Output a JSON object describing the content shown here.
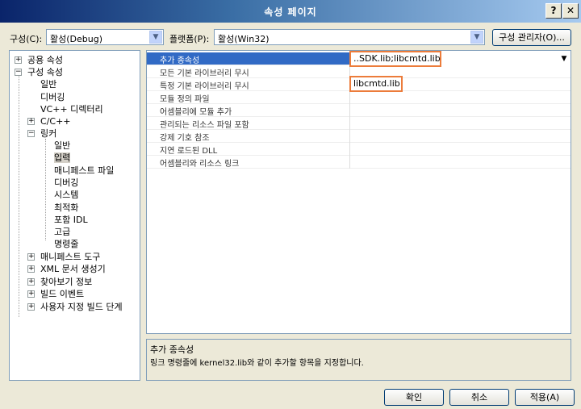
{
  "window": {
    "title": "속성 페이지",
    "help_btn": "?",
    "close_btn": "✕"
  },
  "config": {
    "label": "구성(C):",
    "value": "활성(Debug)"
  },
  "platform": {
    "label": "플랫폼(P):",
    "value": "활성(Win32)"
  },
  "config_manager_button": "구성 관리자(O)...",
  "tree": {
    "common": "공용 속성",
    "config": "구성 속성",
    "general": "일반",
    "debugging": "디버깅",
    "vcdirs": "VC++ 디렉터리",
    "cc": "C/C++",
    "linker": "링커",
    "linker_children": [
      "일반",
      "입력",
      "매니페스트 파일",
      "디버깅",
      "시스템",
      "최적화",
      "포함 IDL",
      "고급",
      "명령줄"
    ],
    "manifest_tool": "매니페스트 도구",
    "xml_doc": "XML 문서 생성기",
    "browse_info": "찾아보기 정보",
    "build_events": "빌드 이벤트",
    "custom_build": "사용자 지정 빌드 단계"
  },
  "properties": [
    {
      "name": "추가 종속성",
      "value": "..SDK.lib;libcmtd.lib"
    },
    {
      "name": "모든 기본 라이브러리 무시",
      "value": ""
    },
    {
      "name": "특정 기본 라이브러리 무시",
      "value": "libcmtd.lib"
    },
    {
      "name": "모듈 정의 파일",
      "value": ""
    },
    {
      "name": "어셈블리에 모듈 추가",
      "value": ""
    },
    {
      "name": "관리되는 리소스 파일 포함",
      "value": ""
    },
    {
      "name": "강제 기호 참조",
      "value": ""
    },
    {
      "name": "지연 로드된 DLL",
      "value": ""
    },
    {
      "name": "어셈블리와 리소스 링크",
      "value": ""
    }
  ],
  "description": {
    "title": "추가 종속성",
    "text": "링크 명령줄에 kernel32.lib와 같이 추가할 항목을 지정합니다."
  },
  "buttons": {
    "ok": "확인",
    "cancel": "취소",
    "apply": "적용(A)"
  },
  "colors": {
    "selection": "#316ac5",
    "highlight_border": "#ec7c3b"
  }
}
